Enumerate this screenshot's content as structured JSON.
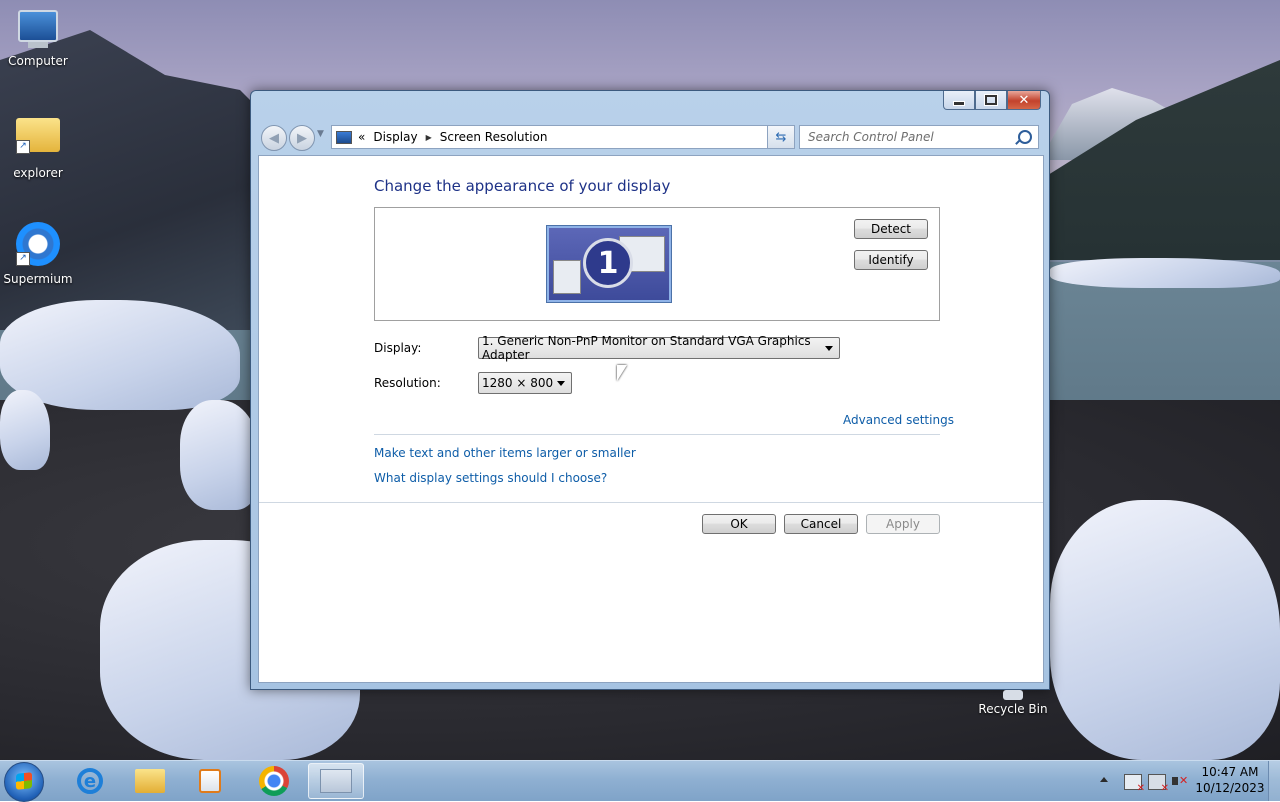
{
  "desktop": {
    "icons": [
      {
        "label": "Computer"
      },
      {
        "label": "explorer"
      },
      {
        "label": "Supermium"
      }
    ],
    "recycle_bin": "Recycle Bin"
  },
  "window": {
    "address": {
      "chevrons": "«",
      "crumbs": [
        "Display",
        "Screen Resolution"
      ]
    },
    "search_placeholder": "Search Control Panel",
    "heading": "Change the appearance of your display",
    "monitor_number": "1",
    "detect_label": "Detect",
    "identify_label": "Identify",
    "display_label": "Display:",
    "display_value": "1. Generic Non-PnP Monitor on Standard VGA Graphics Adapter",
    "resolution_label": "Resolution:",
    "resolution_value": "1280 × 800",
    "advanced_link": "Advanced settings",
    "links": [
      "Make text and other items larger or smaller",
      "What display settings should I choose?"
    ],
    "ok_label": "OK",
    "cancel_label": "Cancel",
    "apply_label": "Apply"
  },
  "taskbar": {
    "apps": [
      "Internet Explorer",
      "Windows Explorer",
      "Windows Media Player",
      "Chrome",
      "Screen Resolution"
    ],
    "time": "10:47 AM",
    "date": "10/12/2023"
  }
}
